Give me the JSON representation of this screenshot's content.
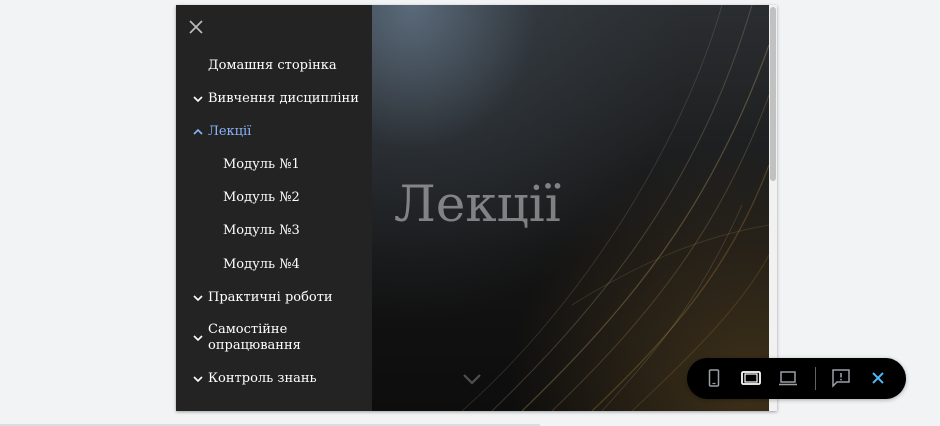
{
  "nav": {
    "items": [
      {
        "label": "Домашня сторінка",
        "chevron": "none"
      },
      {
        "label": "Вивчення дисципліни",
        "chevron": "down"
      },
      {
        "label": "Лекції",
        "chevron": "up",
        "active": true
      },
      {
        "label": "Модуль №1",
        "chevron": "none"
      },
      {
        "label": "Модуль №2",
        "chevron": "none"
      },
      {
        "label": "Модуль №3",
        "chevron": "none"
      },
      {
        "label": "Модуль №4",
        "chevron": "none"
      },
      {
        "label": "Практичні роботи",
        "chevron": "down"
      },
      {
        "label_line1": "Самостійне",
        "label_line2": "опрацювання",
        "chevron": "down"
      },
      {
        "label": "Контроль знань",
        "chevron": "down"
      }
    ]
  },
  "hero": {
    "title": "Лекції"
  },
  "icons": {
    "close_nav": "close-icon",
    "scroll_down": "chevron-down-icon",
    "phone": "phone-icon",
    "tablet": "tablet-icon",
    "laptop": "laptop-icon",
    "feedback": "feedback-icon",
    "exit": "close-icon"
  },
  "colors": {
    "active_link": "#8ab4f8",
    "toolbar_bg": "#000000",
    "exit_icon": "#4db6f5",
    "drawer_bg": "#232323"
  }
}
